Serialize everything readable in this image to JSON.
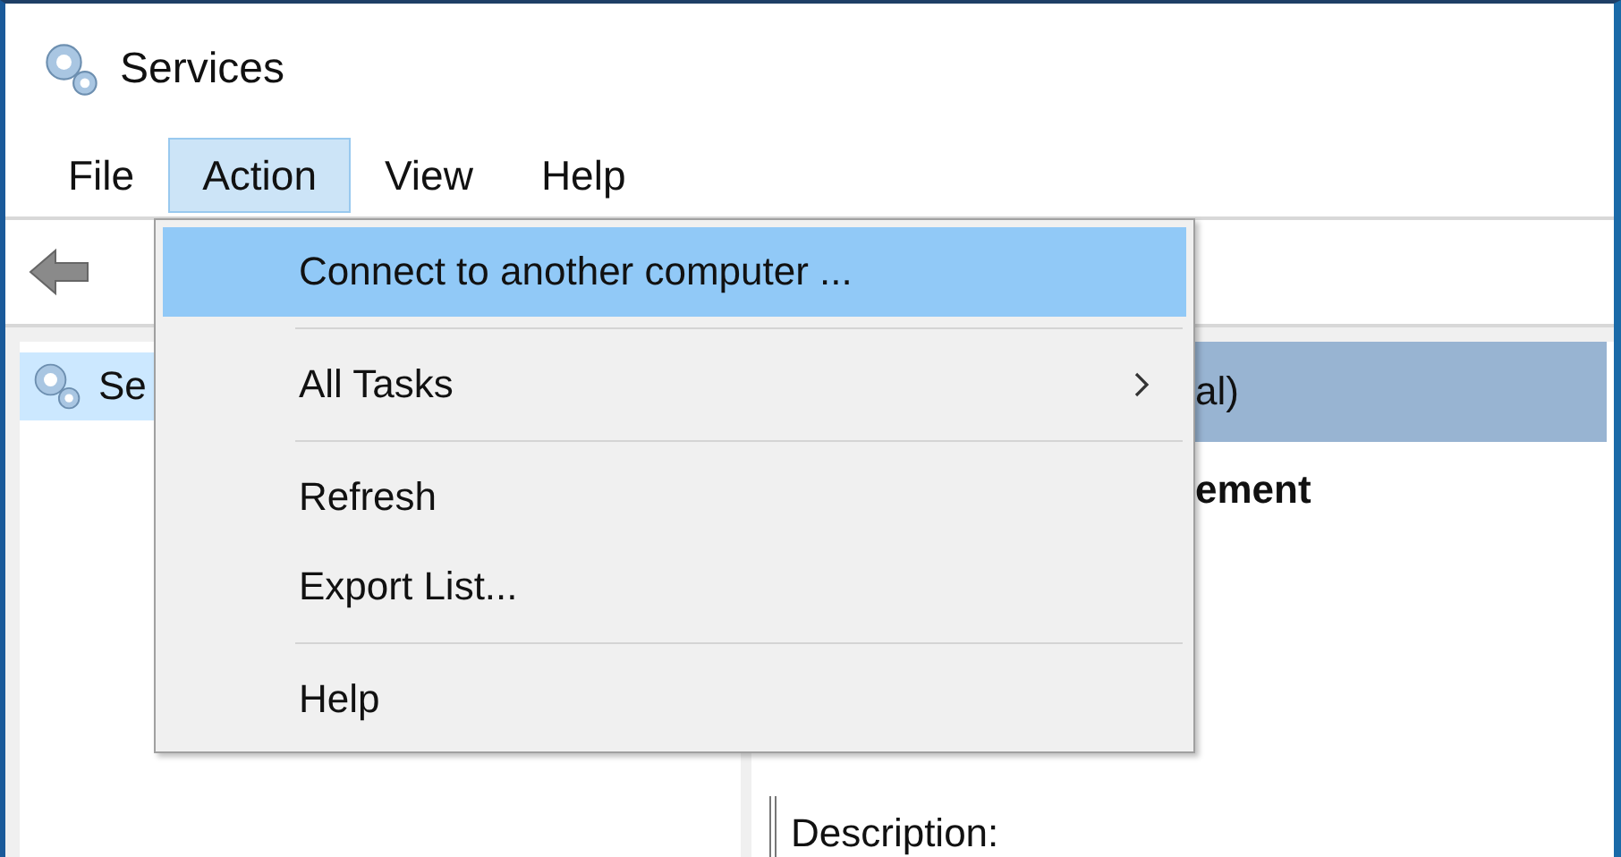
{
  "window": {
    "title": "Services"
  },
  "menu_bar": [
    {
      "label": "File",
      "selected": false
    },
    {
      "label": "Action",
      "selected": true
    },
    {
      "label": "View",
      "selected": false
    },
    {
      "label": "Help",
      "selected": false
    }
  ],
  "tree": {
    "items": [
      {
        "label": "Se",
        "selected": true
      }
    ]
  },
  "details": {
    "header": "al)",
    "service_name": "ement",
    "description_label": "Description:"
  },
  "context_menu": {
    "groups": [
      [
        {
          "label": "Connect to another computer ...",
          "selected": true,
          "submenu": false
        }
      ],
      [
        {
          "label": "All Tasks",
          "selected": false,
          "submenu": true
        }
      ],
      [
        {
          "label": "Refresh",
          "selected": false,
          "submenu": false
        },
        {
          "label": "Export List...",
          "selected": false,
          "submenu": false
        }
      ],
      [
        {
          "label": "Help",
          "selected": false,
          "submenu": false
        }
      ]
    ]
  }
}
